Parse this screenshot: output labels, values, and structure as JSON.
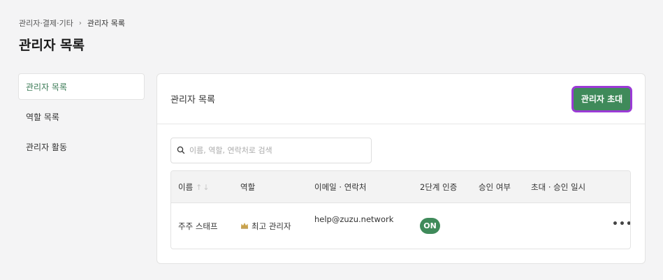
{
  "breadcrumb": {
    "parent": "관리자·결제·기타",
    "separator": "›",
    "current": "관리자 목록"
  },
  "page_title": "관리자 목록",
  "sidebar": {
    "items": [
      {
        "label": "관리자 목록",
        "active": true
      },
      {
        "label": "역할 목록",
        "active": false
      },
      {
        "label": "관리자 활동",
        "active": false
      }
    ]
  },
  "card": {
    "title": "관리자 목록",
    "invite_button": "관리자 초대",
    "search_placeholder": "이름, 역할, 연락처로 검색",
    "search_value": ""
  },
  "table": {
    "headers": {
      "name": "이름",
      "sort_icons": "↑↓",
      "role": "역할",
      "contact": "이메일 · 연락처",
      "twofa": "2단계 인증",
      "approval": "승인 여부",
      "invited_at": "초대 · 승인 일시"
    },
    "rows": [
      {
        "name": "주주 스태프",
        "role_icon": "crown-icon",
        "role": "최고 관리자",
        "contact": "help@zuzu.network",
        "twofa": "ON",
        "approval": "",
        "invited_at": "",
        "more": "•••"
      }
    ]
  },
  "colors": {
    "accent": "#3f8a5a",
    "highlight_border": "#9b3ad6",
    "crown": "#c9a24a"
  }
}
